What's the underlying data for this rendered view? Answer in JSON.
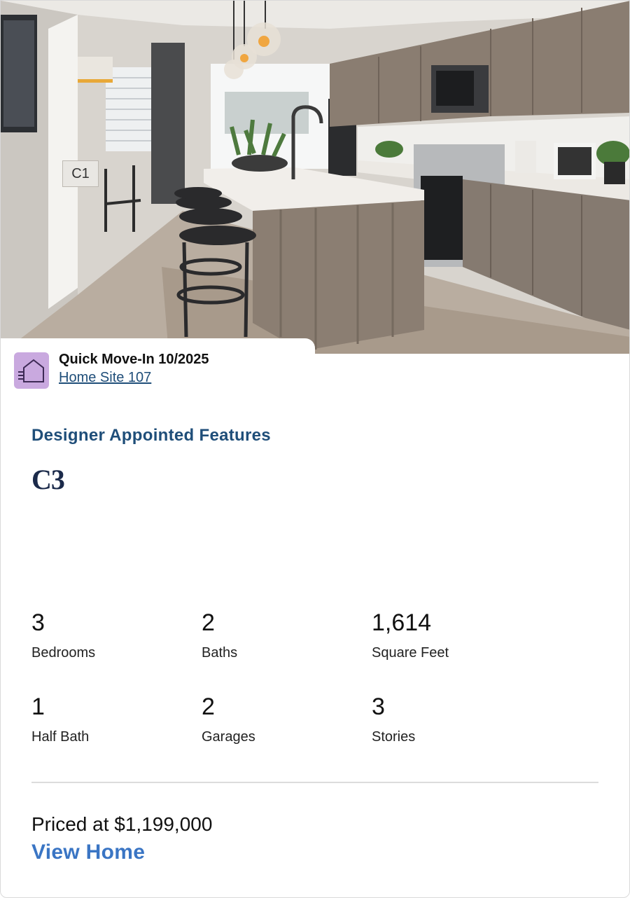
{
  "photo": {
    "plan_tag": "C1"
  },
  "status": {
    "title": "Quick Move-In 10/2025",
    "homesite": "Home Site 107",
    "icon": "house-icon",
    "icon_bg": "#c9a9df"
  },
  "features_heading": "Designer Appointed Features",
  "plan_name": "C3",
  "stats": [
    {
      "value": "3",
      "label": "Bedrooms"
    },
    {
      "value": "2",
      "label": "Baths"
    },
    {
      "value": "1,614",
      "label": "Square Feet"
    },
    {
      "value": "1",
      "label": "Half Bath"
    },
    {
      "value": "2",
      "label": "Garages"
    },
    {
      "value": "3",
      "label": "Stories"
    }
  ],
  "price": "Priced at $1,199,000",
  "cta": "View Home",
  "colors": {
    "heading": "#1f4e79",
    "cta": "#3a75c4"
  }
}
